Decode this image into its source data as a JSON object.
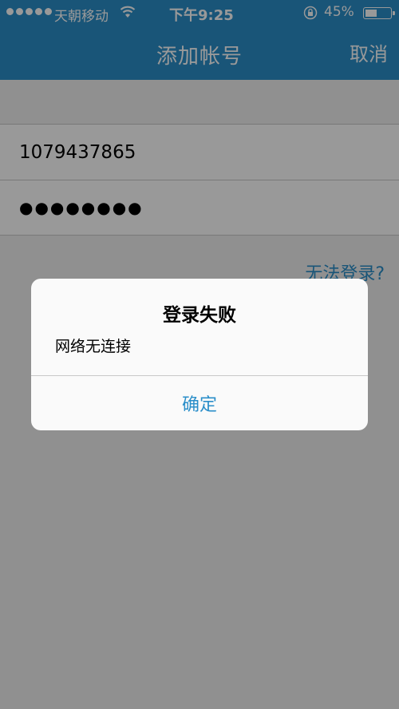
{
  "status_bar": {
    "carrier": "天朝移动",
    "time": "下午9:25",
    "battery_percent": "45%",
    "battery_level": 0.45,
    "signal_bars": 5
  },
  "nav": {
    "title": "添加帐号",
    "cancel_label": "取消"
  },
  "form": {
    "account_value": "1079437865",
    "password_value": "●●●●●●●●"
  },
  "links": {
    "cant_login": "无法登录?"
  },
  "dialog": {
    "title": "登录失败",
    "message": "网络无连接",
    "confirm_label": "确定"
  },
  "colors": {
    "accent": "#2a8ec9",
    "overlay": "rgba(0,0,0,0.40)"
  },
  "icons": [
    "signal-dots-icon",
    "wifi-icon",
    "rotation-lock-icon",
    "battery-icon"
  ]
}
